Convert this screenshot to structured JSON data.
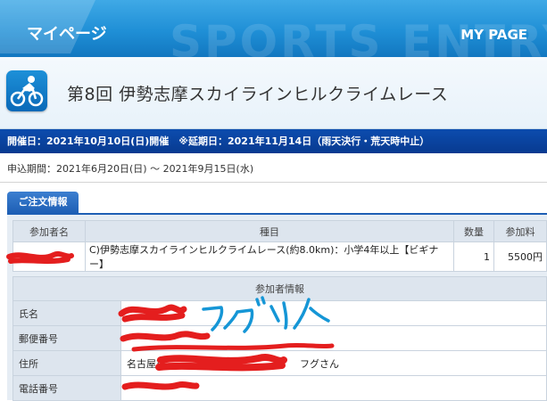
{
  "header": {
    "title_left": "マイページ",
    "title_right": "MY PAGE",
    "watermark": "SPORTS ENTRY"
  },
  "event": {
    "icon": "cyclist-icon",
    "title": "第8回 伊勢志摩スカイラインヒルクライムレース"
  },
  "date_bar": {
    "text": "開催日：2021年10月10日(日)開催　※延期日：2021年11月14日（雨天決行・荒天時中止）"
  },
  "apply_period": {
    "text": "申込期間：2021年6月20日(日) 〜 2021年9月15日(水)"
  },
  "order_tab": {
    "label": "ご注文情報"
  },
  "order_table": {
    "headers": [
      "参加者名",
      "種目",
      "数量",
      "参加料"
    ],
    "rows": [
      {
        "name": "",
        "event": "C)伊勢志摩スカイラインヒルクライムレース(約8.0km)：小学4年以上【ビギナー】",
        "qty": "1",
        "fee": "5500円"
      }
    ]
  },
  "participant_info": {
    "title": "参加者情報",
    "rows": [
      {
        "label": "氏名",
        "value": ""
      },
      {
        "label": "郵便番号",
        "value": ""
      },
      {
        "label": "住所",
        "value_prefix": "名古屋市",
        "value_suffix": "フグさん"
      },
      {
        "label": "電話番号",
        "value": ""
      }
    ]
  },
  "annotation": {
    "handwritten_text": "フグダリバ",
    "color": "#1596d6"
  },
  "colors": {
    "banner_blue": "#1f8fd6",
    "date_bar_navy": "#0a429e",
    "tab_blue": "#1e5fb5",
    "redaction_red": "#e41e1e"
  }
}
